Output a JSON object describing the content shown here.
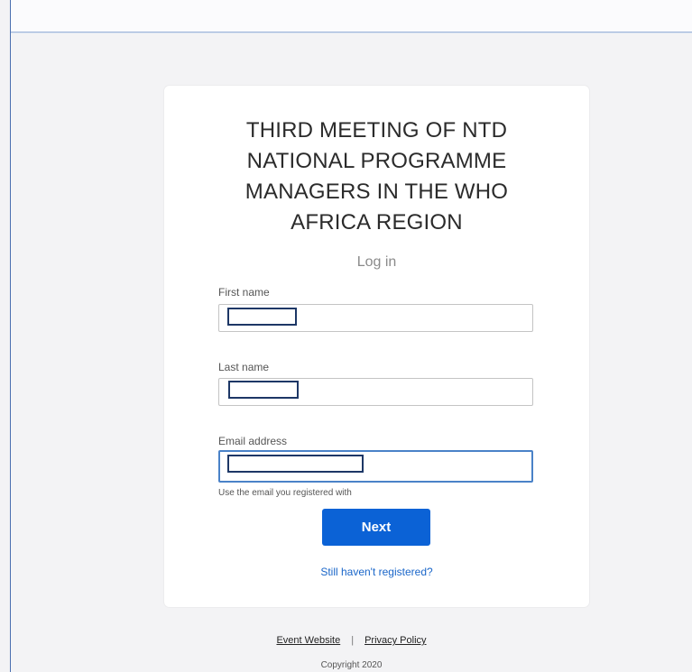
{
  "login_card": {
    "title": "THIRD MEETING OF NTD NATIONAL PROGRAMME MANAGERS IN THE WHO AFRICA REGION",
    "subtitle": "Log in",
    "first_name": {
      "label": "First name",
      "value": ""
    },
    "last_name": {
      "label": "Last name",
      "value": ""
    },
    "email": {
      "label": "Email address",
      "value": "",
      "helper": "Use the email you registered with"
    },
    "next_button": "Next",
    "register_link": "Still haven't registered?"
  },
  "footer": {
    "event_website": "Event Website",
    "separator": "|",
    "privacy_policy": "Privacy Policy",
    "copyright": "Copyright 2020"
  },
  "colors": {
    "primary_button": "#0b62d6",
    "link": "#1a66c9",
    "focus_border": "#4a82c8"
  }
}
